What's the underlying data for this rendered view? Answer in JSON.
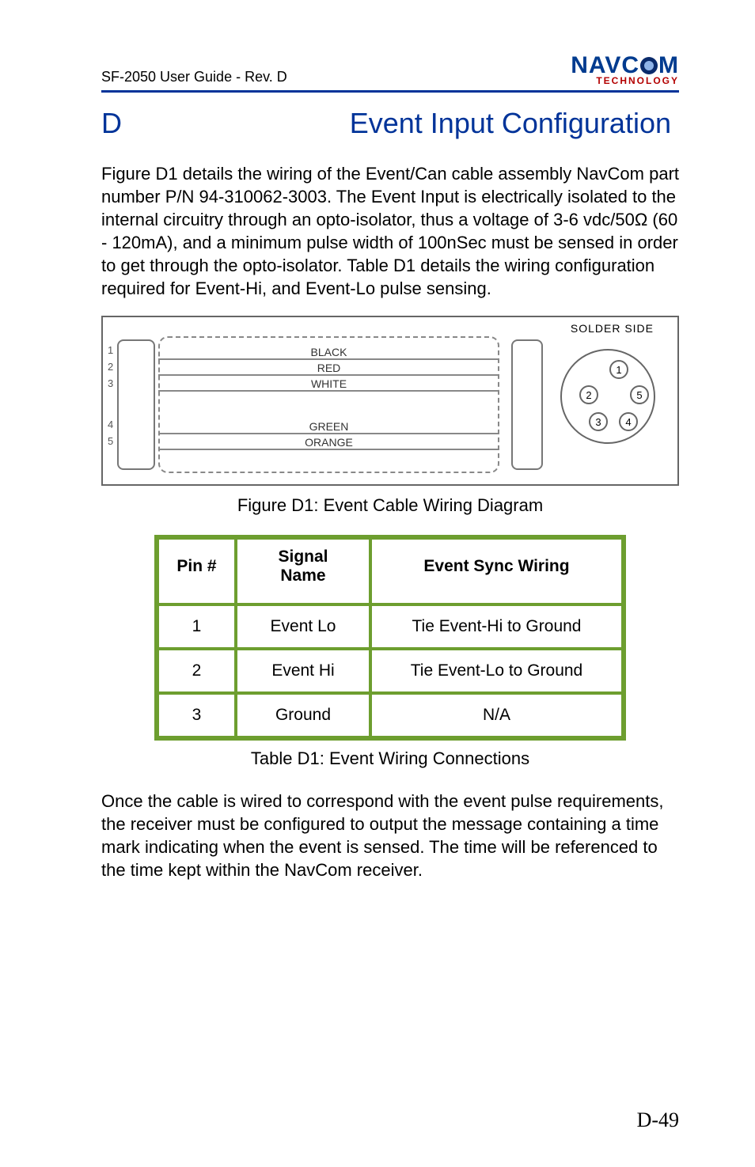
{
  "header": {
    "doc_title": "SF-2050 User Guide - Rev. D",
    "logo_top_left": "NAVC",
    "logo_top_right": "M",
    "logo_bottom": "TECHNOLOGY"
  },
  "appendix": {
    "letter": "D",
    "title": "Event Input Configuration"
  },
  "para1": "Figure D1 details the wiring of the Event/Can cable assembly NavCom part number P/N 94-310062-3003. The Event Input is electrically isolated to the internal circuitry through an opto-isolator, thus a voltage of 3-6 vdc/50Ω (60 - 120mA), and a minimum pulse width of 100nSec must be sensed in order to get through the opto-isolator. Table D1 details the wiring configuration required for Event-Hi, and Event-Lo pulse sensing.",
  "wiring": {
    "solder_side": "SOLDER SIDE",
    "pins": {
      "p1": "1",
      "p2": "2",
      "p3": "3",
      "p4": "4",
      "p5": "5"
    },
    "wires": {
      "w1": "BLACK",
      "w2": "RED",
      "w3": "WHITE",
      "w4": "GREEN",
      "w5": "ORANGE"
    },
    "round": {
      "r1": "1",
      "r2": "2",
      "r3": "3",
      "r4": "4",
      "r5": "5"
    }
  },
  "fig_caption": "Figure D1: Event Cable Wiring Diagram",
  "table": {
    "headers": {
      "pin": "Pin #",
      "signal": "Signal\nName",
      "event": "Event Sync Wiring"
    },
    "rows": [
      {
        "pin": "1",
        "signal": "Event Lo",
        "event": "Tie Event-Hi to Ground"
      },
      {
        "pin": "2",
        "signal": "Event  Hi",
        "event": "Tie Event-Lo to Ground"
      },
      {
        "pin": "3",
        "signal": "Ground",
        "event": "N/A"
      }
    ]
  },
  "table_caption": "Table D1: Event Wiring Connections",
  "para2": "Once the cable is wired to correspond with the event pulse requirements, the receiver must be configured to output the message containing a time mark indicating when the event is sensed. The time will be referenced to the time kept within the NavCom receiver.",
  "page_number": "D-49"
}
